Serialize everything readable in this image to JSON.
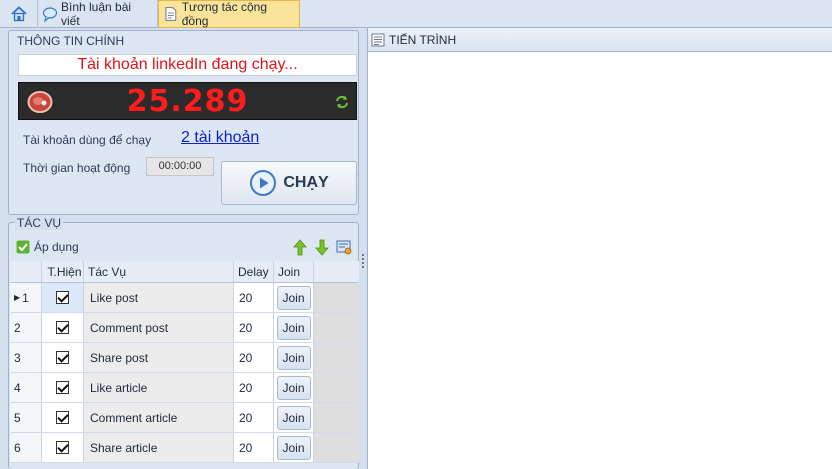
{
  "tabs": {
    "home_icon": "home-icon",
    "items": [
      {
        "label": "Bình luận bài viết",
        "icon": "comment-icon"
      },
      {
        "label": "Tương tác cộng đồng",
        "icon": "document-icon",
        "active": true
      }
    ]
  },
  "info": {
    "title": "THÔNG TIN CHÍNH",
    "status": "Tài khoản linkedIn đang chạy...",
    "counter": "25.289",
    "account_label": "Tài khoản dùng để chạy",
    "account_value": "2 tài khoản",
    "time_label": "Thời gian hoạt động",
    "time_value": "00:00:00",
    "run_label": "CHẠY"
  },
  "tasks": {
    "title": "TÁC VỤ",
    "apply_label": "Áp dụng",
    "columns": [
      "T.Hiện",
      "Tác Vụ",
      "Delay",
      "Join"
    ],
    "rows": [
      {
        "num": "1",
        "checked": true,
        "task": "Like post",
        "delay": "20",
        "join": "Join"
      },
      {
        "num": "2",
        "checked": true,
        "task": "Comment post",
        "delay": "20",
        "join": "Join"
      },
      {
        "num": "3",
        "checked": true,
        "task": "Share post",
        "delay": "20",
        "join": "Join"
      },
      {
        "num": "4",
        "checked": true,
        "task": "Like article",
        "delay": "20",
        "join": "Join"
      },
      {
        "num": "5",
        "checked": true,
        "task": "Comment article",
        "delay": "20",
        "join": "Join"
      },
      {
        "num": "6",
        "checked": true,
        "task": "Share article",
        "delay": "20",
        "join": "Join"
      }
    ]
  },
  "progress": {
    "title": "TIẾN TRÌNH"
  },
  "colors": {
    "status_text": "#e0141c",
    "counter_text": "#ff1c1c",
    "link": "#0d1fd0",
    "active_tab": "#fbe39a"
  }
}
